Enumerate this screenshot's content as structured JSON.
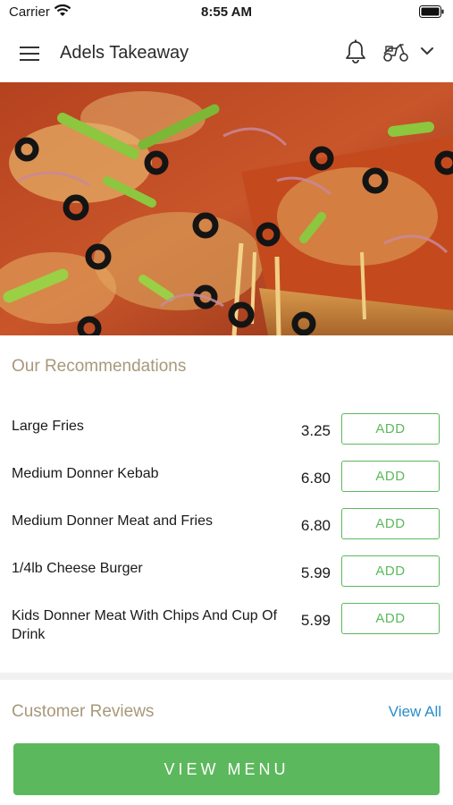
{
  "status_bar": {
    "carrier": "Carrier",
    "time": "8:55 AM"
  },
  "header": {
    "title": "Adels Takeaway"
  },
  "icons": {
    "menu": "hamburger-menu-icon",
    "bell": "bell-icon",
    "delivery": "scooter-icon",
    "dropdown": "chevron-down-icon"
  },
  "hero": {
    "image": "pizza-photo"
  },
  "recommendations": {
    "title": "Our Recommendations",
    "items": [
      {
        "name": "Large Fries",
        "price": "3.25",
        "button": "ADD"
      },
      {
        "name": "Medium Donner Kebab",
        "price": "6.80",
        "button": "ADD"
      },
      {
        "name": "Medium Donner Meat and Fries",
        "price": "6.80",
        "button": "ADD"
      },
      {
        "name": "1/4lb Cheese Burger",
        "price": "5.99",
        "button": "ADD"
      },
      {
        "name": "Kids Donner Meat With Chips And Cup Of Drink",
        "price": "5.99",
        "button": "ADD"
      }
    ]
  },
  "reviews": {
    "title": "Customer Reviews",
    "view_all": "View All"
  },
  "footer": {
    "view_menu": "VIEW MENU"
  },
  "colors": {
    "accent_green": "#5cb85c",
    "link_blue": "#2a8ec9",
    "section_title": "#a8987a"
  }
}
